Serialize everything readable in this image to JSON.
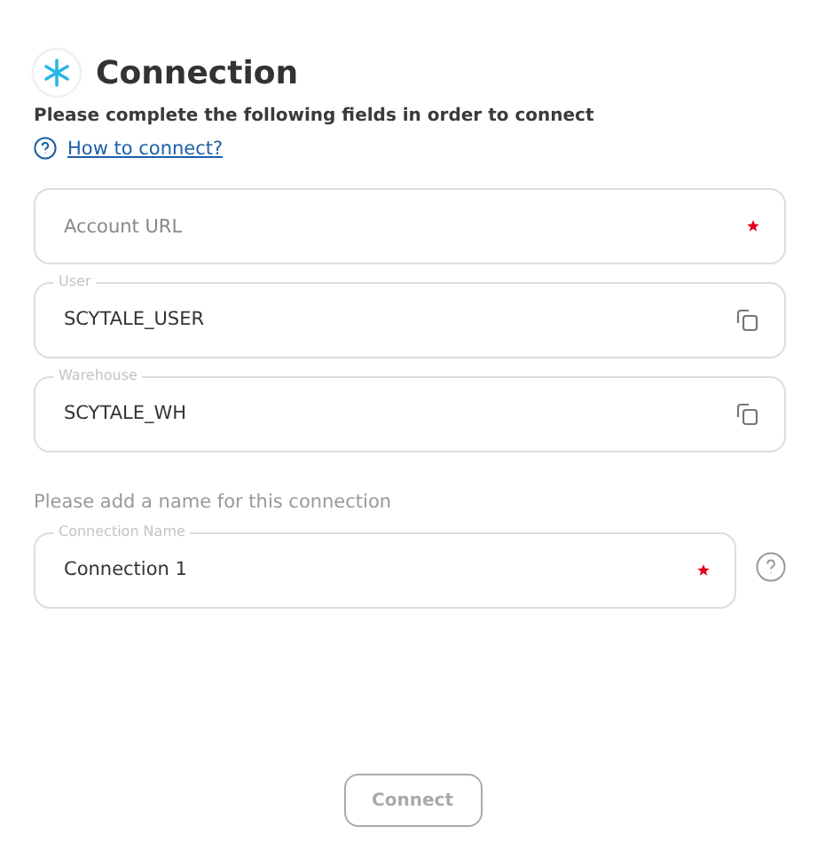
{
  "header": {
    "title": "Connection",
    "subtitle": "Please complete the following fields in order to connect",
    "help_link": "How to connect?"
  },
  "fields": [
    {
      "placeholder": "Account URL",
      "required": true,
      "copyable": false,
      "help": false
    },
    {
      "label": "User",
      "value": "SCYTALE_USER",
      "required": false,
      "copyable": true,
      "help": false
    }
  ],
  "fields_2": [
    {
      "label": "Warehouse",
      "value": "SCYTALE_WH",
      "required": false,
      "copyable": true,
      "help": false
    }
  ],
  "name_prompt": "Please add a name for this connection",
  "fields_3": [
    {
      "label": "Connection Name",
      "value": "Connection 1",
      "required": true,
      "copyable": false,
      "help": true
    }
  ],
  "connect_button": {
    "label": "Connect",
    "disabled": true
  }
}
